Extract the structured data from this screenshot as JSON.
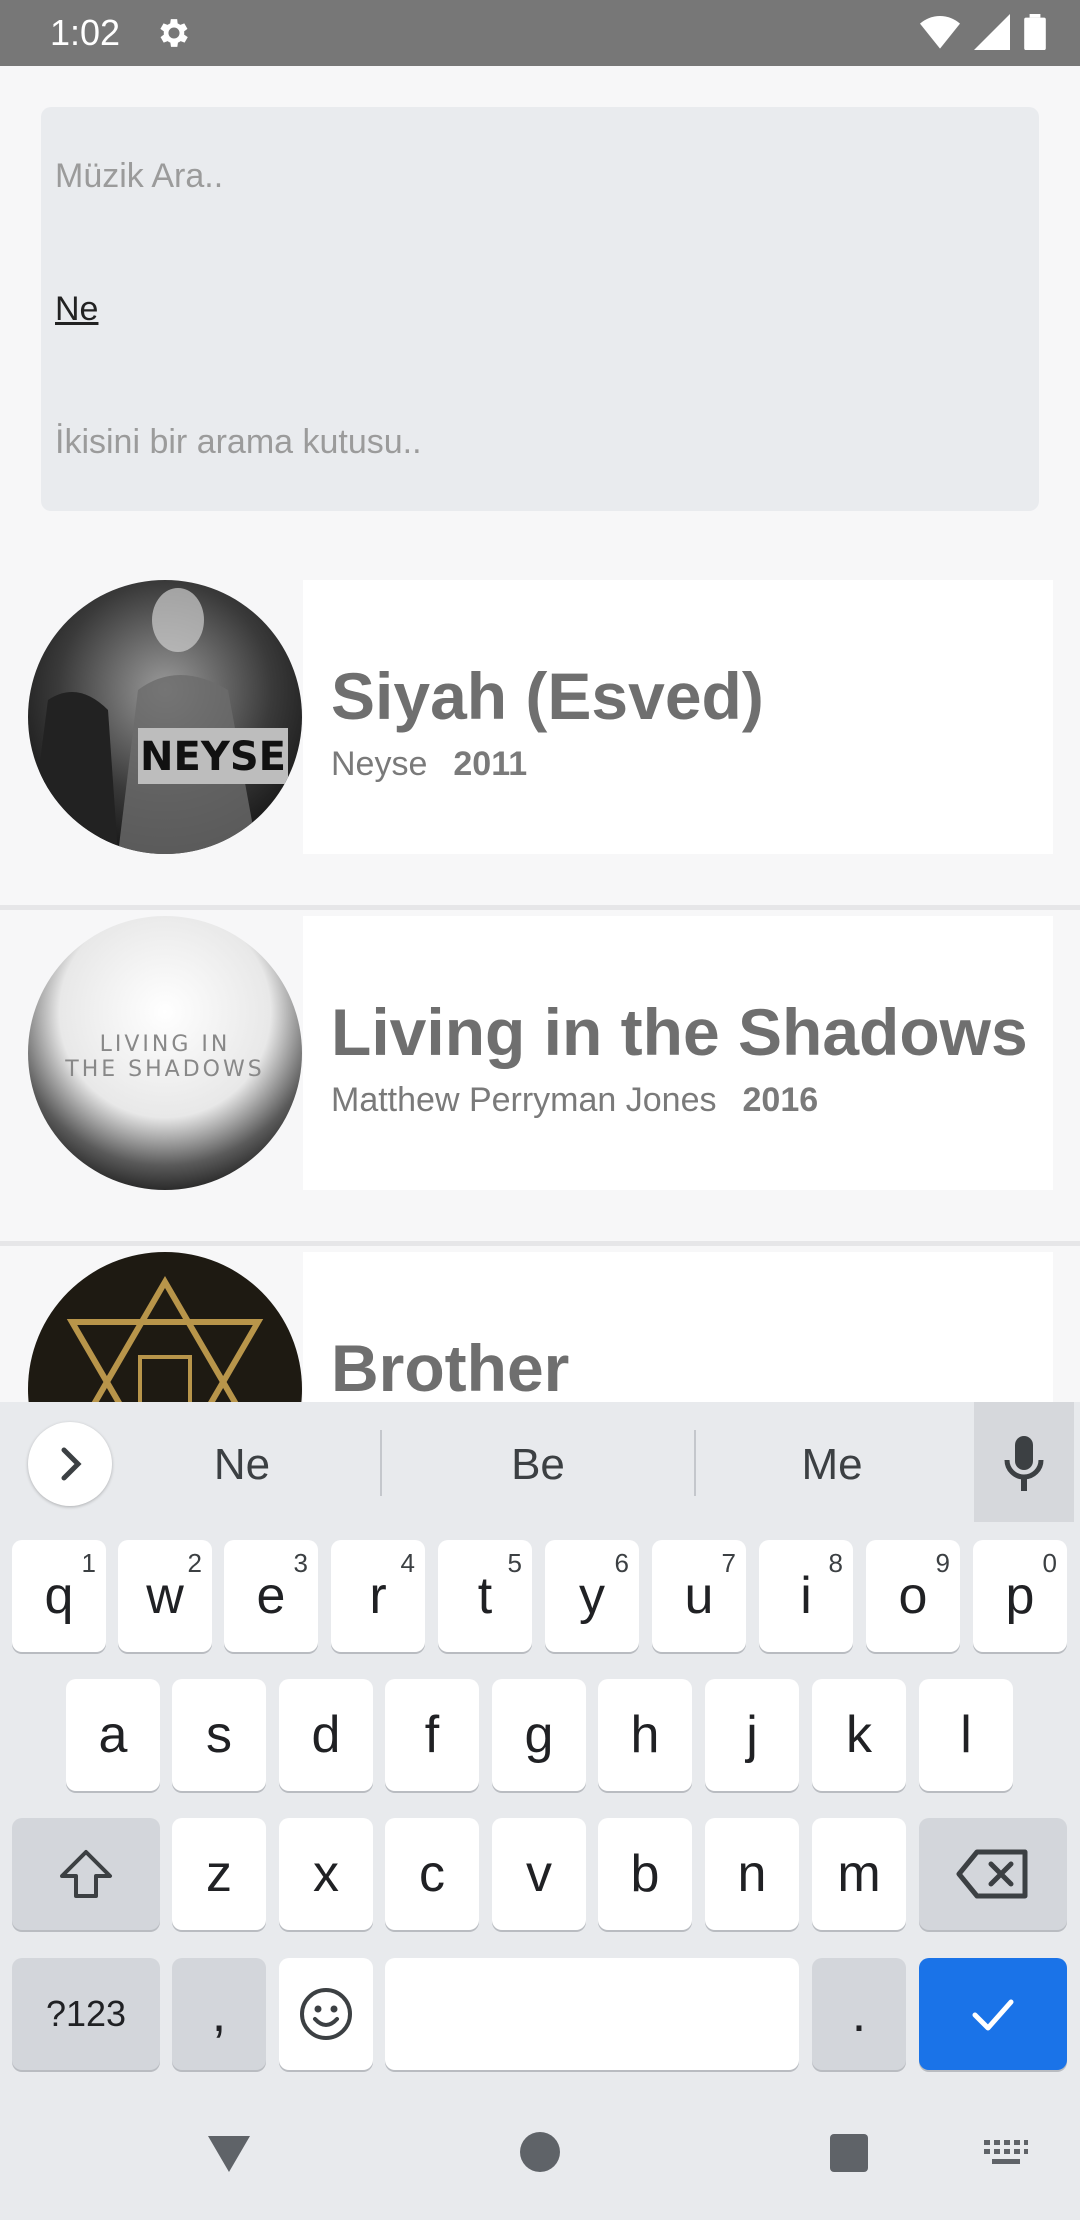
{
  "status_bar": {
    "time": "1:02"
  },
  "search": {
    "placeholder": "Müzik Ara..",
    "value": "Ne",
    "hint": "İkisini bir arama kutusu.."
  },
  "songs": [
    {
      "title": "Siyah (Esved)",
      "artist": "Neyse",
      "year": "2011",
      "art_text": "NEYSE"
    },
    {
      "title": "Living in the Shadows",
      "artist": "Matthew Perryman Jones",
      "year": "2016",
      "art_line1": "LIVING IN",
      "art_line2": "THE SHADOWS"
    },
    {
      "title": "Brother",
      "artist": "",
      "year": ""
    }
  ],
  "keyboard": {
    "suggestions": [
      "Ne",
      "Be",
      "Me"
    ],
    "row1": [
      {
        "key": "q",
        "alt": "1"
      },
      {
        "key": "w",
        "alt": "2"
      },
      {
        "key": "e",
        "alt": "3"
      },
      {
        "key": "r",
        "alt": "4"
      },
      {
        "key": "t",
        "alt": "5"
      },
      {
        "key": "y",
        "alt": "6"
      },
      {
        "key": "u",
        "alt": "7"
      },
      {
        "key": "i",
        "alt": "8"
      },
      {
        "key": "o",
        "alt": "9"
      },
      {
        "key": "p",
        "alt": "0"
      }
    ],
    "row2": [
      "a",
      "s",
      "d",
      "f",
      "g",
      "h",
      "j",
      "k",
      "l"
    ],
    "row3": [
      "z",
      "x",
      "c",
      "v",
      "b",
      "n",
      "m"
    ],
    "symbols_label": "?123",
    "comma": ",",
    "period": "."
  },
  "colors": {
    "accent": "#1a73e8",
    "status_bar": "#777777",
    "search_bg": "#e9ebee"
  }
}
